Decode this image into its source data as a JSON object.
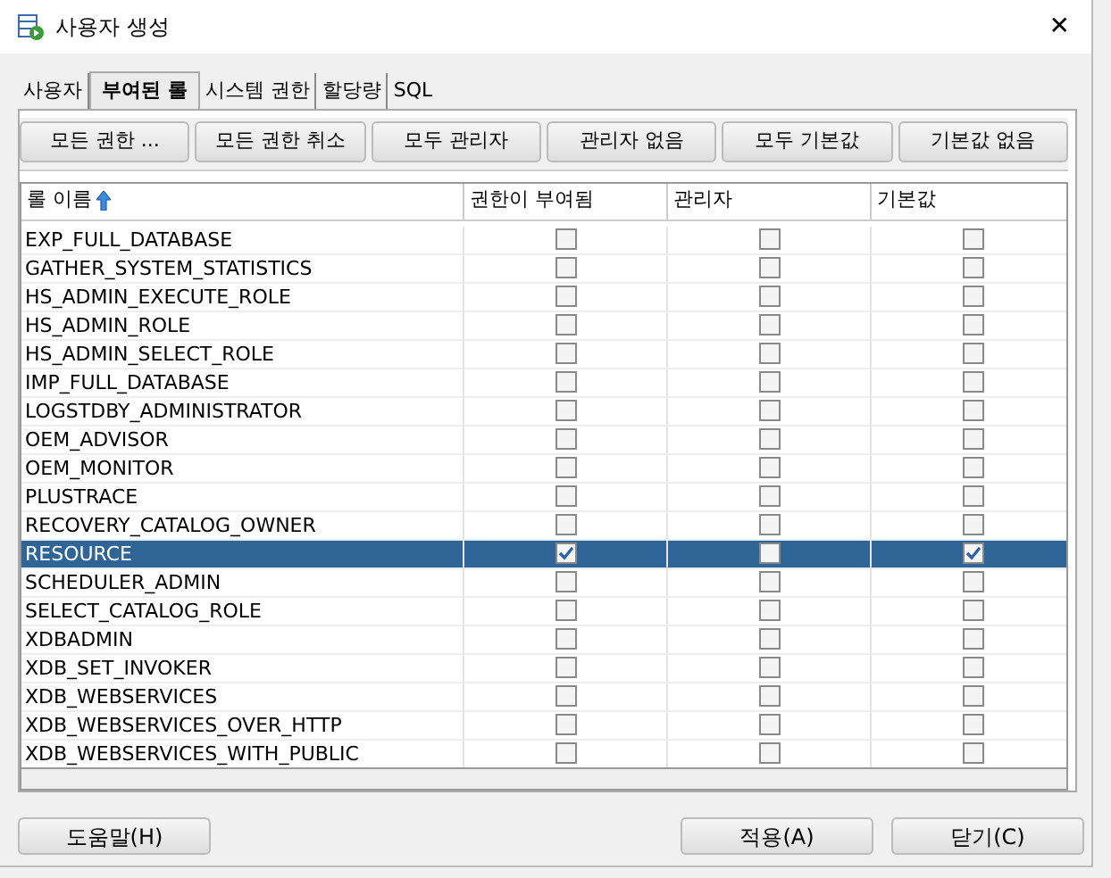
{
  "window": {
    "title": "사용자 생성",
    "close": "✕"
  },
  "tabs": [
    {
      "label": "사용자",
      "selected": false
    },
    {
      "label": "부여된 롤",
      "selected": true
    },
    {
      "label": "시스템 권한",
      "selected": false
    },
    {
      "label": "할당량",
      "selected": false
    },
    {
      "label": "SQL",
      "selected": false
    }
  ],
  "toolbar": [
    "모든 권한 ...",
    "모든 권한 취소",
    "모두 관리자",
    "관리자 없음",
    "모두 기본값",
    "기본값 없음"
  ],
  "table": {
    "columns": [
      {
        "label": "롤 이름",
        "sorted": true
      },
      {
        "label": "권한이 부여됨",
        "sorted": false
      },
      {
        "label": "관리자",
        "sorted": false
      },
      {
        "label": "기본값",
        "sorted": false
      }
    ],
    "rows": [
      {
        "name": "EXP_FULL_DATABASE",
        "granted": false,
        "admin": false,
        "default": false,
        "selected": false
      },
      {
        "name": "GATHER_SYSTEM_STATISTICS",
        "granted": false,
        "admin": false,
        "default": false,
        "selected": false
      },
      {
        "name": "HS_ADMIN_EXECUTE_ROLE",
        "granted": false,
        "admin": false,
        "default": false,
        "selected": false
      },
      {
        "name": "HS_ADMIN_ROLE",
        "granted": false,
        "admin": false,
        "default": false,
        "selected": false
      },
      {
        "name": "HS_ADMIN_SELECT_ROLE",
        "granted": false,
        "admin": false,
        "default": false,
        "selected": false
      },
      {
        "name": "IMP_FULL_DATABASE",
        "granted": false,
        "admin": false,
        "default": false,
        "selected": false
      },
      {
        "name": "LOGSTDBY_ADMINISTRATOR",
        "granted": false,
        "admin": false,
        "default": false,
        "selected": false
      },
      {
        "name": "OEM_ADVISOR",
        "granted": false,
        "admin": false,
        "default": false,
        "selected": false
      },
      {
        "name": "OEM_MONITOR",
        "granted": false,
        "admin": false,
        "default": false,
        "selected": false
      },
      {
        "name": "PLUSTRACE",
        "granted": false,
        "admin": false,
        "default": false,
        "selected": false
      },
      {
        "name": "RECOVERY_CATALOG_OWNER",
        "granted": false,
        "admin": false,
        "default": false,
        "selected": false
      },
      {
        "name": "RESOURCE",
        "granted": true,
        "admin": false,
        "default": true,
        "selected": true
      },
      {
        "name": "SCHEDULER_ADMIN",
        "granted": false,
        "admin": false,
        "default": false,
        "selected": false
      },
      {
        "name": "SELECT_CATALOG_ROLE",
        "granted": false,
        "admin": false,
        "default": false,
        "selected": false
      },
      {
        "name": "XDBADMIN",
        "granted": false,
        "admin": false,
        "default": false,
        "selected": false
      },
      {
        "name": "XDB_SET_INVOKER",
        "granted": false,
        "admin": false,
        "default": false,
        "selected": false
      },
      {
        "name": "XDB_WEBSERVICES",
        "granted": false,
        "admin": false,
        "default": false,
        "selected": false
      },
      {
        "name": "XDB_WEBSERVICES_OVER_HTTP",
        "granted": false,
        "admin": false,
        "default": false,
        "selected": false
      },
      {
        "name": "XDB_WEBSERVICES_WITH_PUBLIC",
        "granted": false,
        "admin": false,
        "default": false,
        "selected": false
      }
    ]
  },
  "footer": {
    "left": [
      "도움말(H)"
    ],
    "right": [
      "적용(A)",
      "닫기(C)"
    ]
  }
}
